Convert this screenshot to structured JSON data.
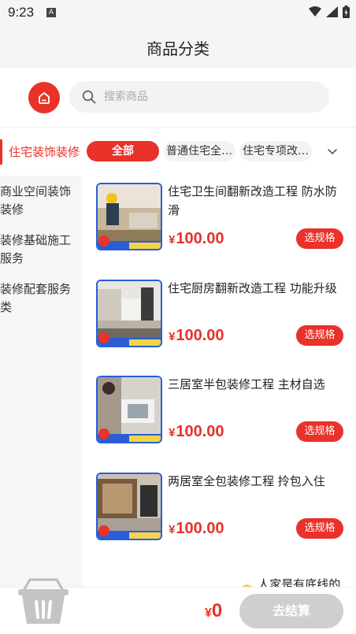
{
  "status_bar": {
    "time": "9:23",
    "badge": "A"
  },
  "header": {
    "title": "商品分类"
  },
  "search": {
    "placeholder": "搜索商品"
  },
  "category_row": {
    "main": "住宅装饰装修",
    "chips": [
      "全部",
      "普通住宅全…",
      "住宅专项改…"
    ]
  },
  "sidebar": {
    "items": [
      "商业空间装饰装修",
      "装修基础施工服务",
      "装修配套服务类"
    ]
  },
  "products": [
    {
      "name": "住宅卫生间翻新改造工程 防水防滑",
      "currency": "¥",
      "price": "100.00",
      "button": "选规格"
    },
    {
      "name": "住宅厨房翻新改造工程 功能升级",
      "currency": "¥",
      "price": "100.00",
      "button": "选规格"
    },
    {
      "name": "三居室半包装修工程 主材自选",
      "currency": "¥",
      "price": "100.00",
      "button": "选规格"
    },
    {
      "name": "两居室全包装修工程 拎包入住",
      "currency": "¥",
      "price": "100.00",
      "button": "选规格"
    }
  ],
  "list_end_text": "人家是有底线的~~",
  "footer": {
    "currency": "¥",
    "total": "0",
    "checkout": "去结算"
  },
  "colors": {
    "accent": "#e8322a",
    "disabled": "#cfcfcf",
    "thumb_border": "#2b5ed6"
  },
  "icons": [
    "home-icon",
    "search-icon",
    "chevron-down-icon",
    "cart-basket-icon",
    "smiley-icon",
    "wifi-icon",
    "signal-icon",
    "battery-icon"
  ]
}
